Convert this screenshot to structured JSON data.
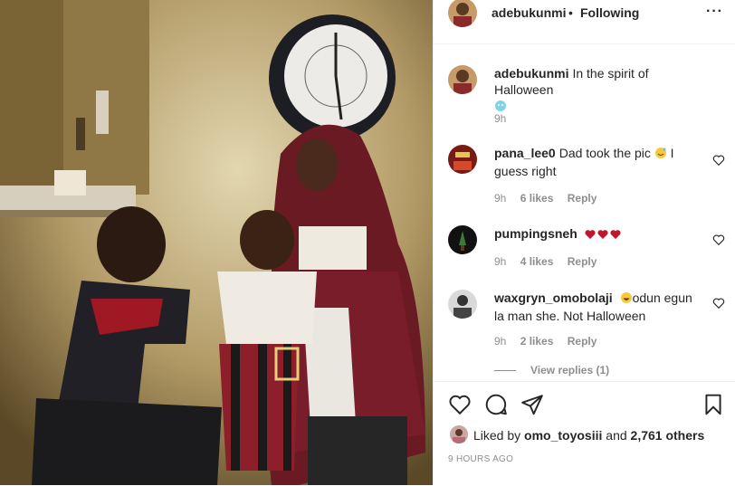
{
  "post": {
    "author": "adebukunmi",
    "follow_state": "Following",
    "dot": "•",
    "more_label": "···",
    "caption": {
      "user": "adebukunmi",
      "text": "In the spirit of Halloween",
      "time": "9h"
    },
    "comments": [
      {
        "user": "pana_lee0",
        "text": "Dad took the pic",
        "text2": "I guess right",
        "time": "9h",
        "likes": "6 likes",
        "reply": "Reply"
      },
      {
        "user": "pumpingsneh",
        "text": "",
        "time": "9h",
        "likes": "4 likes",
        "reply": "Reply"
      },
      {
        "user": "waxgryn_omobolaji",
        "text": "odun egun la man she. Not Halloween",
        "time": "9h",
        "likes": "2 likes",
        "reply": "Reply"
      }
    ],
    "view_replies": "View replies (1)",
    "liked_by": {
      "prefix": "Liked by",
      "user": "omo_toyosiii",
      "middle": "and",
      "count": "2,761 others"
    },
    "timestamp": "9 HOURS AGO"
  },
  "colors": {
    "heart_red": "#c0152a",
    "meta_gray": "#8e8e8e",
    "text": "#262626",
    "border": "#efefef"
  },
  "icons": [
    "heart-icon",
    "comment-icon",
    "share-icon",
    "bookmark-icon",
    "more-icon"
  ]
}
